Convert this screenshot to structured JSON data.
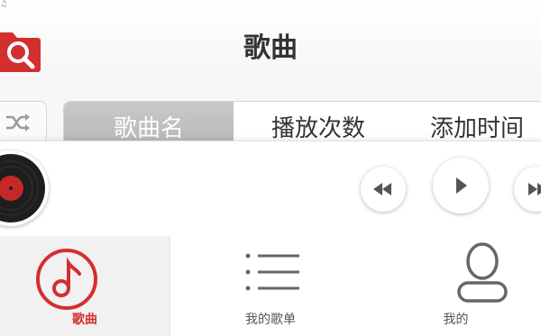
{
  "status": {
    "glyph": "♫"
  },
  "header": {
    "title": "歌曲",
    "left_icon": "folder-search-icon"
  },
  "sort_tabs": {
    "shuffle_icon": "shuffle-icon",
    "items": [
      {
        "label": "歌曲名",
        "active": true
      },
      {
        "label": "播放次数",
        "active": false
      },
      {
        "label": "添加时间",
        "active": false
      }
    ]
  },
  "player": {
    "album_icon": "vinyl-record-icon",
    "controls": [
      "rewind-icon",
      "play-icon",
      "fast-forward-icon"
    ]
  },
  "bottom_nav": {
    "items": [
      {
        "label": "歌曲",
        "icon": "music-note-icon",
        "active": true
      },
      {
        "label": "我的歌单",
        "icon": "list-icon",
        "active": false
      },
      {
        "label": "我的",
        "icon": "person-icon",
        "active": false
      }
    ]
  },
  "colors": {
    "accent": "#d32f2f",
    "active_tab": "#bdbdbd",
    "text": "#333333"
  }
}
